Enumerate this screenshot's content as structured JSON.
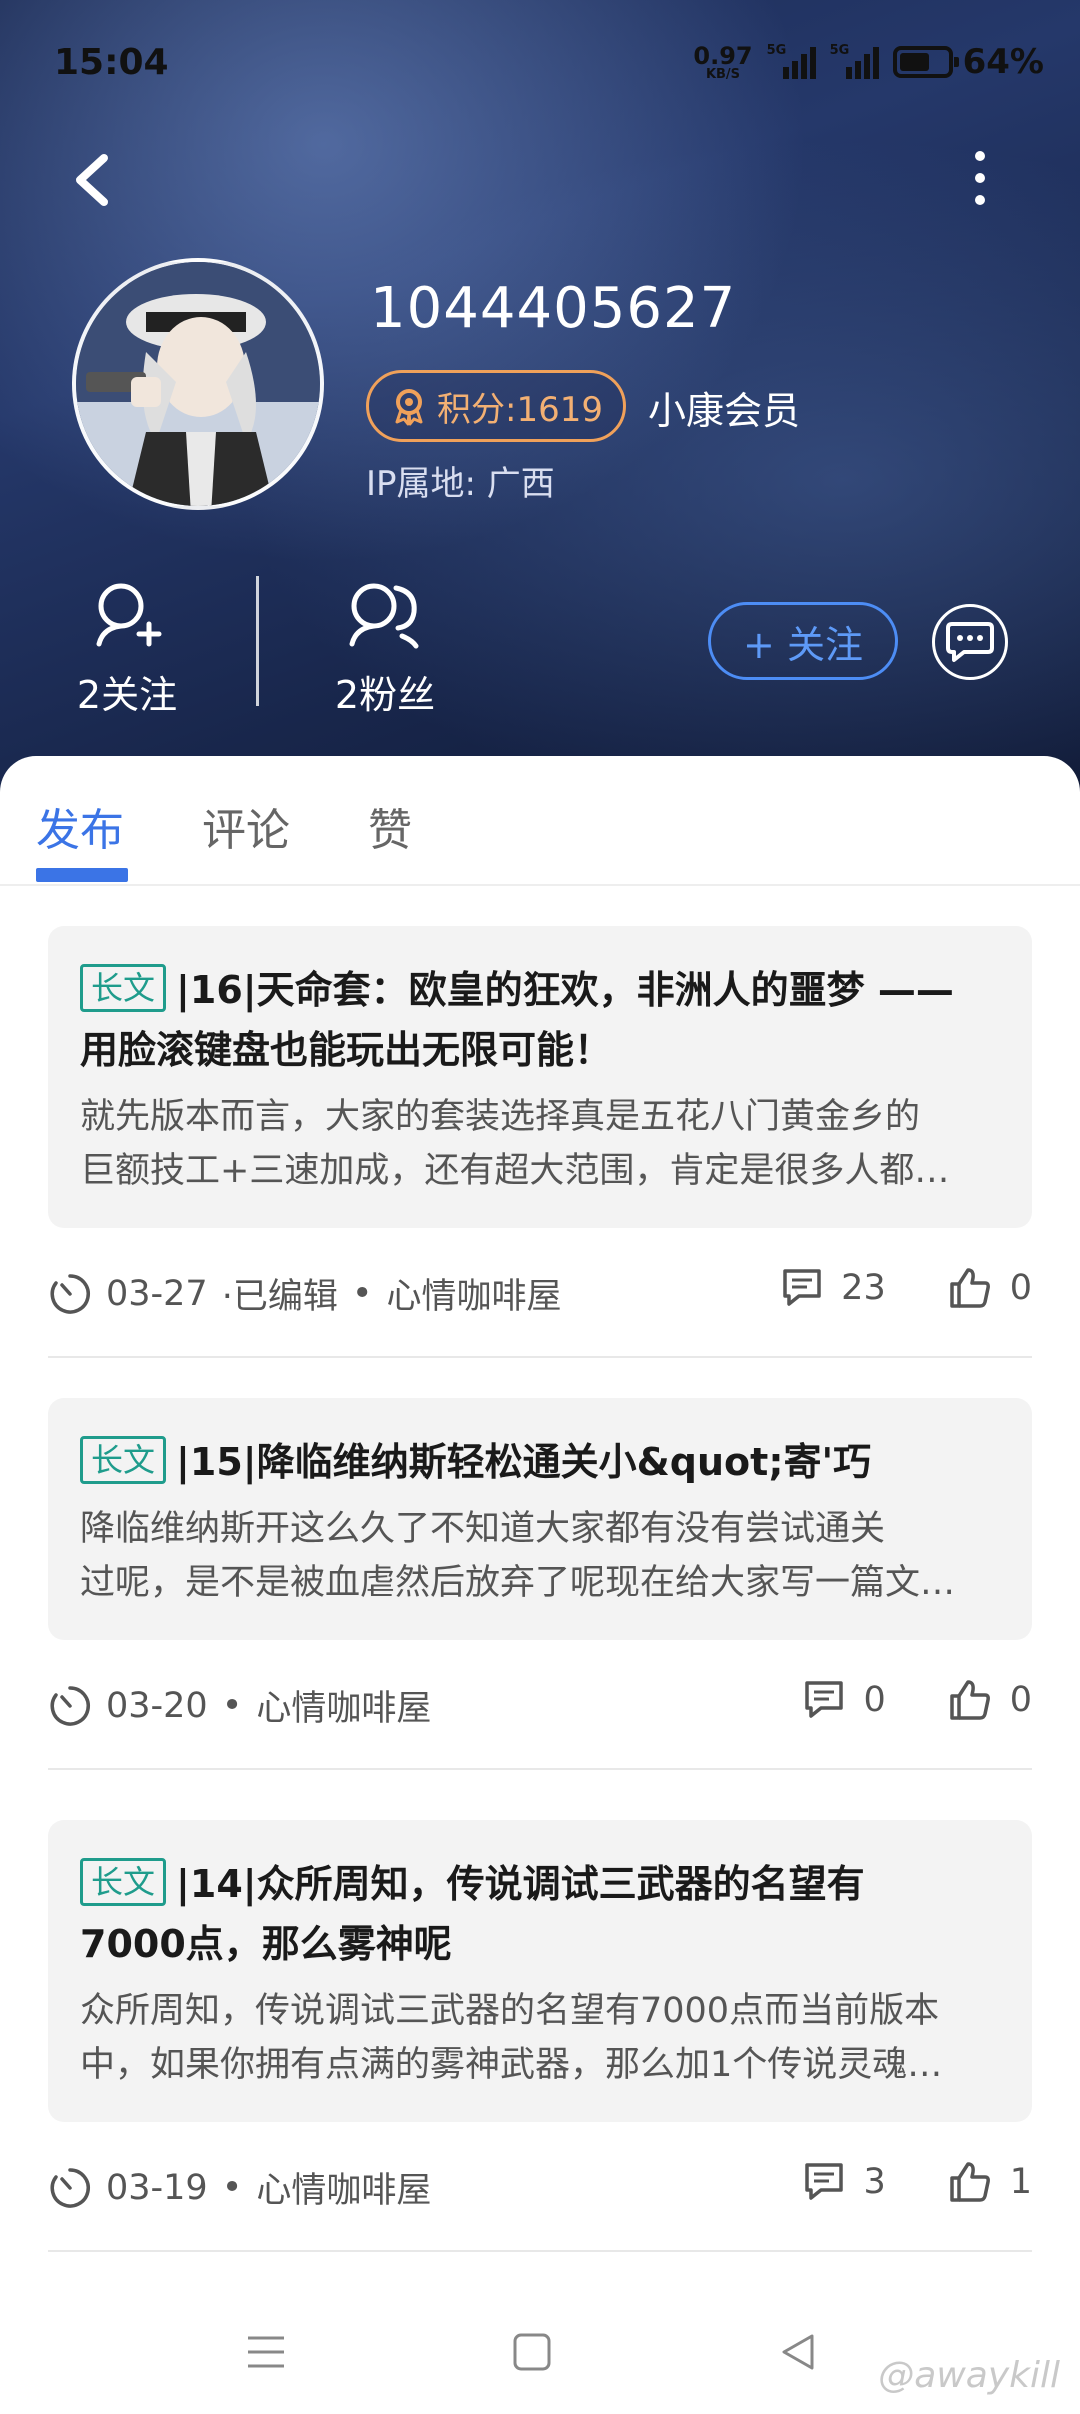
{
  "status_bar": {
    "time": "15:04",
    "net_speed": "0.97",
    "net_unit": "KB/S",
    "signal1_tag": "5G",
    "signal2_tag": "5G",
    "battery_text": "64%",
    "battery_level": 0.64
  },
  "profile": {
    "username": "1044405627",
    "points": "积分:1619",
    "member_label": "小康会员",
    "ip_location": "IP属地: 广西",
    "following": "2关注",
    "followers": "2粉丝",
    "follow_button": "+ 关注"
  },
  "tabs": [
    {
      "label": "发布",
      "active": true
    },
    {
      "label": "评论",
      "active": false
    },
    {
      "label": "赞",
      "active": false
    }
  ],
  "posts": [
    {
      "tag": "长文",
      "title_line1": "|16|天命套：欧皇的狂欢，非洲人的噩梦 ——",
      "title_line2": "用脸滚键盘也能玩出无限可能！",
      "excerpt_line1": " 就先版本而言，大家的套装选择真是五花八门黄金乡的",
      "excerpt_line2": "巨额技工+三速加成，还有超大范围，肯定是很多人都…",
      "date": "03-27",
      "edited": "·已编辑",
      "dot": "•",
      "forum": "心情咖啡屋",
      "comments": "23",
      "likes": "0"
    },
    {
      "tag": "长文",
      "title_line1": "|15|降临维纳斯轻松通关小&quot;寄'巧",
      "title_line2": "",
      "excerpt_line1": "降临维纳斯开这么久了不知道大家都有没有尝试通关",
      "excerpt_line2": "过呢，是不是被血虐然后放弃了呢现在给大家写一篇文…",
      "date": "03-20",
      "edited": "",
      "dot": "•",
      "forum": "心情咖啡屋",
      "comments": "0",
      "likes": "0"
    },
    {
      "tag": "长文",
      "title_line1": "|14|众所周知，传说调试三武器的名望有",
      "title_line2": "7000点，那么雾神呢",
      "excerpt_line1": "众所周知，传说调试三武器的名望有7000点而当前版本",
      "excerpt_line2": "中，如果你拥有点满的雾神武器，那么加1个传说灵魂…",
      "date": "03-19",
      "edited": "",
      "dot": "•",
      "forum": "心情咖啡屋",
      "comments": "3",
      "likes": "1"
    }
  ],
  "watermark": "@awaykill",
  "colors": {
    "accent": "#3b74e6",
    "points": "#f0a15a",
    "tag": "#1f9c8c"
  }
}
